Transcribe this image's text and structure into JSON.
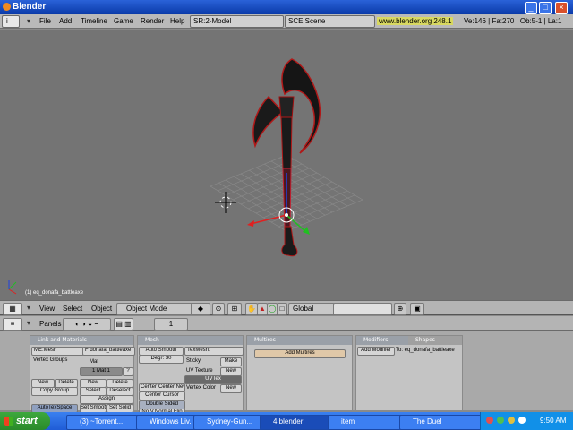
{
  "window": {
    "title": "Blender"
  },
  "header": {
    "menus": [
      "File",
      "Add",
      "Timeline",
      "Game",
      "Render",
      "Help"
    ],
    "screen_field": "SR:2-Model",
    "scene_field": "SCE:Scene",
    "url": "www.blender.org 248.1",
    "stats": "Ve:146 | Fa:270 | Ob:5-1 | La:1"
  },
  "viewport": {
    "object_label": "(1) eq_donafa_battleaxe"
  },
  "view3d_header": {
    "menus": [
      "View",
      "Select",
      "Object"
    ],
    "mode": "Object Mode",
    "orientation": "Global"
  },
  "buttons_header": {
    "label": "Panels",
    "frame": "1"
  },
  "panels": {
    "link_materials": {
      "title": "Link and Materials",
      "me": "ME:Mesh",
      "ob": "F donafa_battleaxe",
      "vertex_groups": "Vertex Groups",
      "mat": "Mat",
      "mat_index": "1 Mat 1",
      "new": "New",
      "delete": "Delete",
      "copy_group": "Copy Group",
      "new2": "New",
      "delete2": "Delete",
      "select": "Select",
      "deselect": "Deselect",
      "assign": "Assign",
      "autotex": "AutoTexSpace",
      "set_smooth": "Set Smooth",
      "set_solid": "Set Solid"
    },
    "mesh": {
      "title": "Mesh",
      "auto_smooth": "Auto Smooth",
      "degr": "Degr: 30",
      "texmesh": "TexMesh:",
      "sticky": "Sticky",
      "make": "Make",
      "uv_texture": "UV Texture",
      "new": "New",
      "uvtex": "UVTex",
      "vertex_color": "Vertex Color",
      "new_vc": "New",
      "center": "Center",
      "center_new": "Center New",
      "center_cursor": "Center Cursor",
      "double_sided": "Double Sided",
      "no_vnormal_flip": "No V.Normal Flip"
    },
    "multires": {
      "title": "Multires",
      "add_multires": "Add Multires"
    },
    "modifiers": {
      "title": "Modifiers",
      "shapes_tab": "Shapes",
      "add_modifier": "Add Modifier",
      "to": "To: eq_donafa_battleaxe"
    }
  },
  "taskbar": {
    "start": "start",
    "tasks": [
      "(3) ~Torrent...",
      "Windows Liv...",
      "Sydney-Gun...",
      "4 blender",
      "item",
      "The Duel"
    ],
    "clock": "9:50 AM"
  }
}
